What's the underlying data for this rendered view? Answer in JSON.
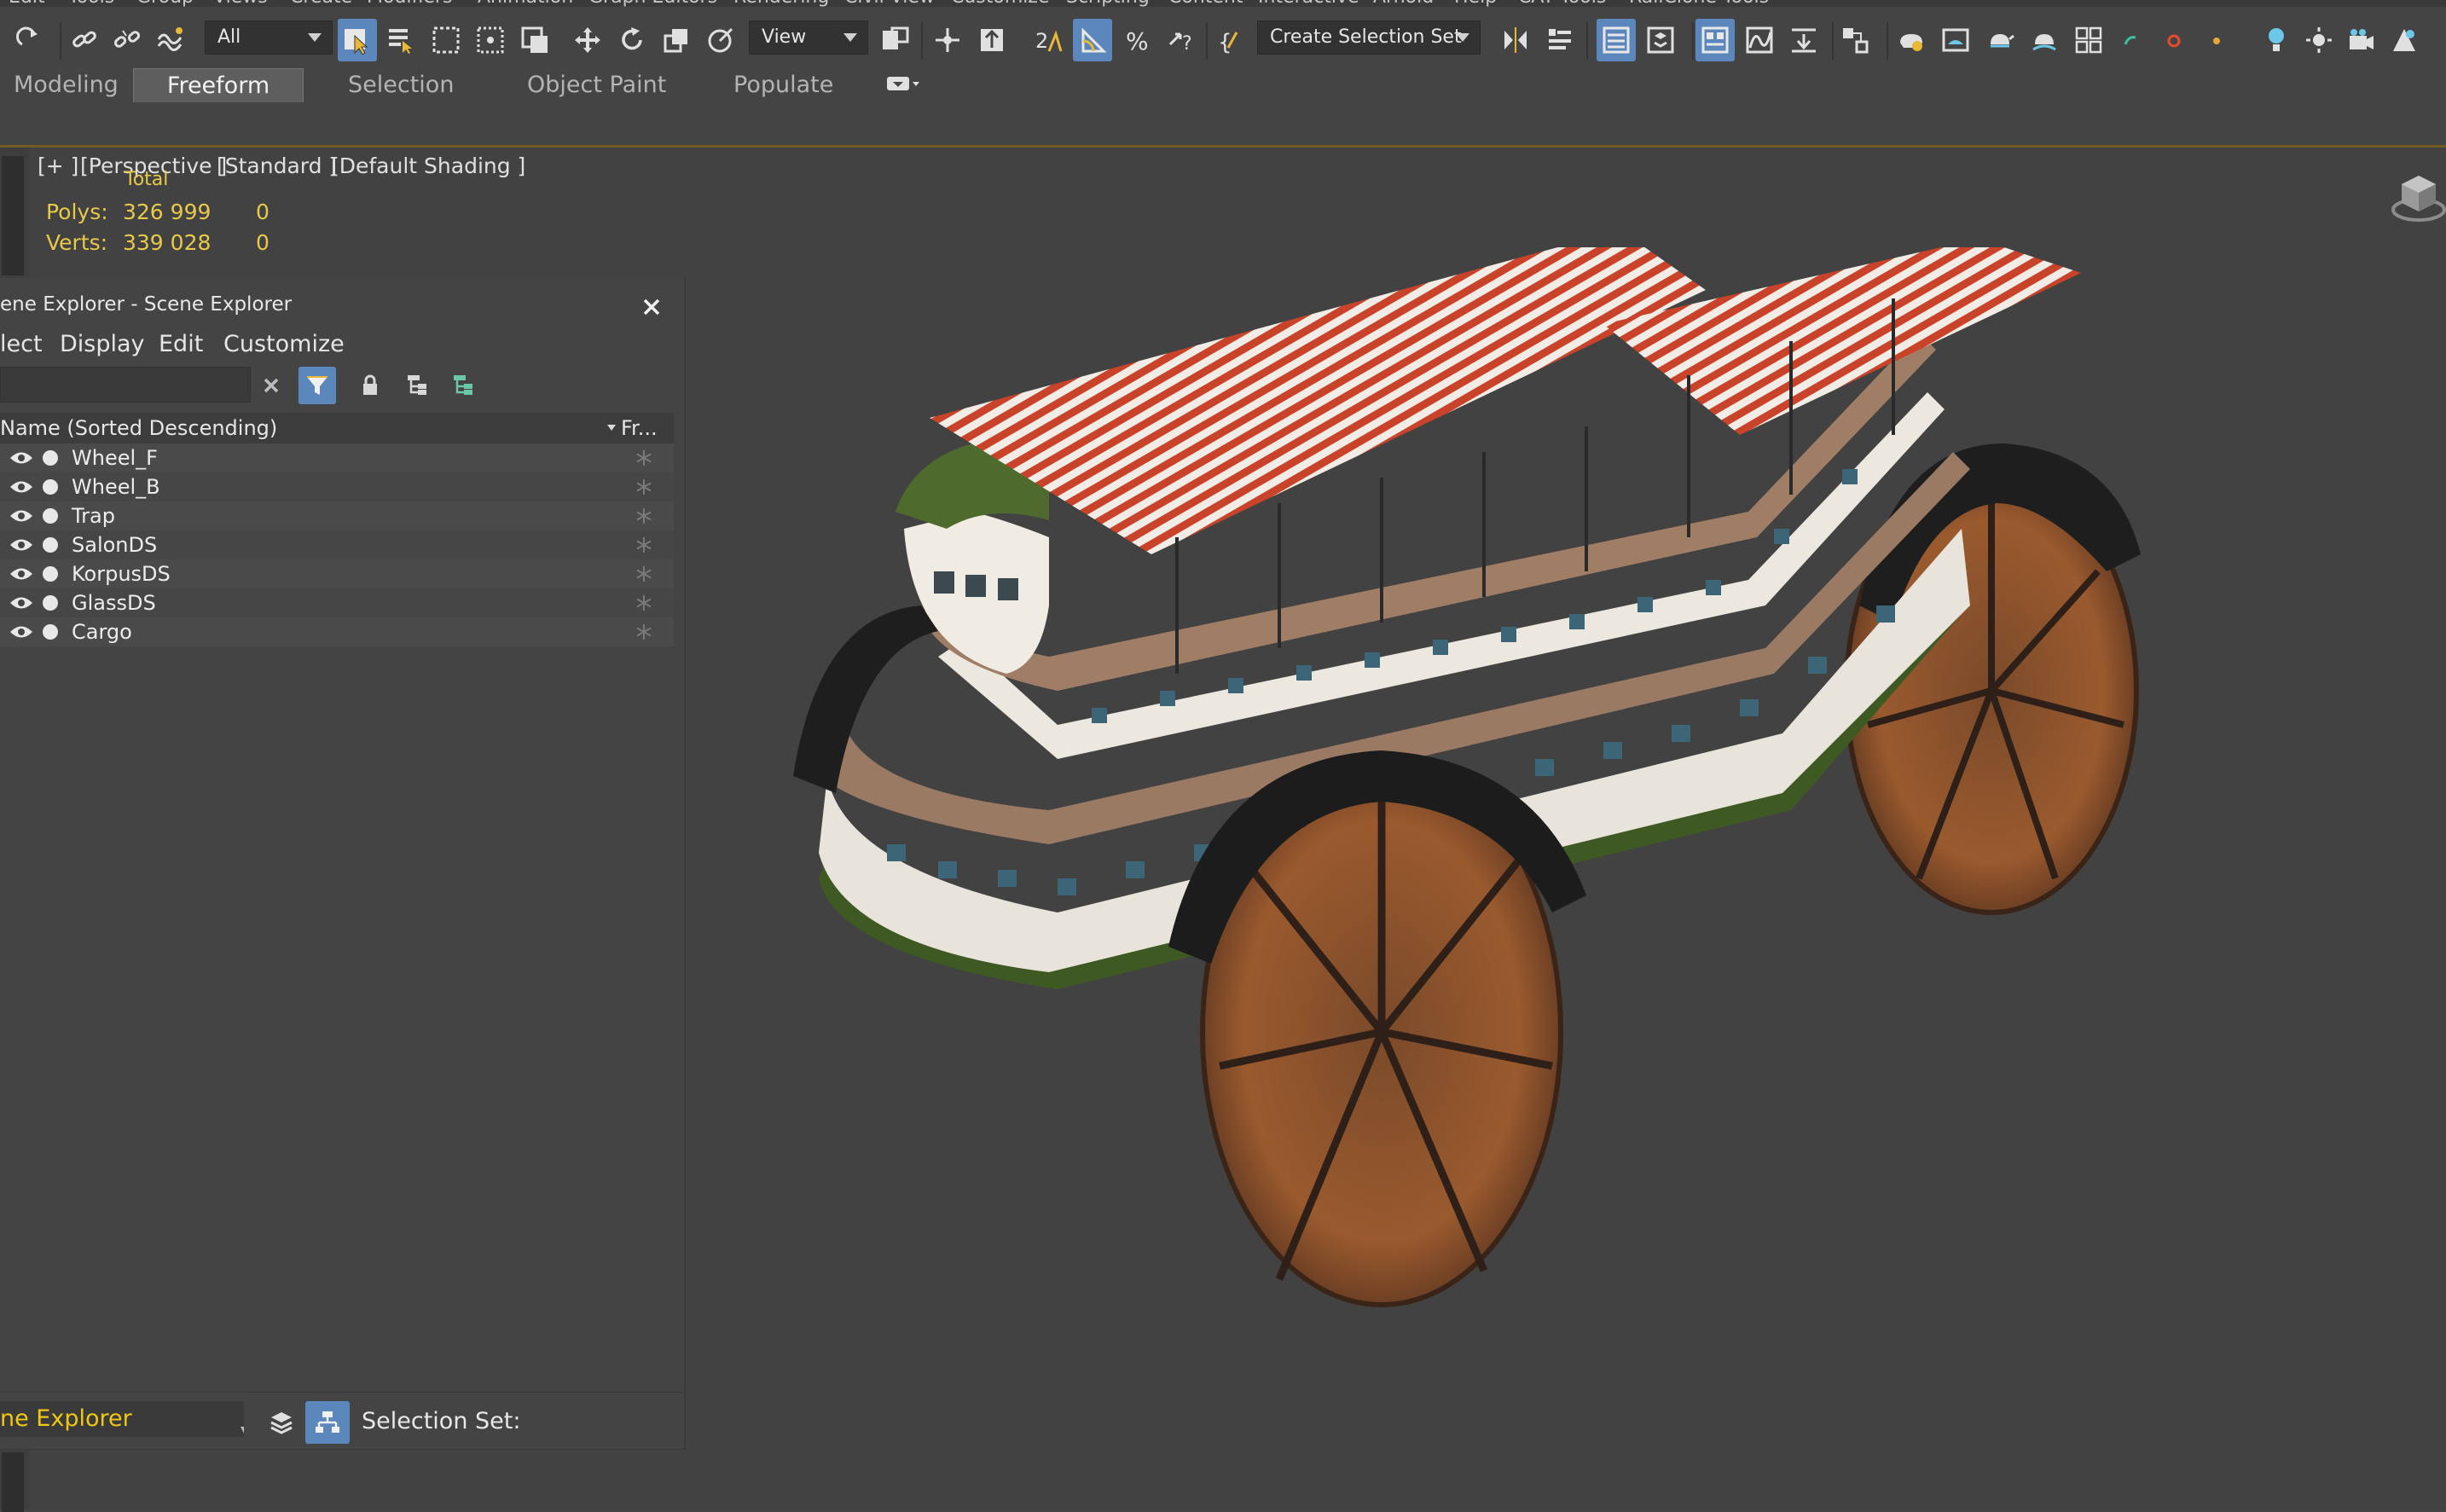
{
  "menubar": {
    "items": [
      "Edit",
      "Tools",
      "Group",
      "Views",
      "Create",
      "Modifiers",
      "Animation",
      "Graph Editors",
      "Rendering",
      "Civil View",
      "Customize",
      "Scripting",
      "Content",
      "Interactive",
      "Arnold",
      "Help",
      "CAT Tools",
      "RailClone Tools"
    ]
  },
  "toolbar": {
    "selection_filter": "All",
    "reference_coord": "View",
    "named_selection_set": "Create Selection Set"
  },
  "ribbon": {
    "tabs": [
      {
        "label": "Modeling",
        "active": false
      },
      {
        "label": "Freeform",
        "active": true
      },
      {
        "label": "Selection",
        "active": false
      },
      {
        "label": "Object Paint",
        "active": false
      },
      {
        "label": "Populate",
        "active": false
      }
    ]
  },
  "viewport": {
    "label_plus": "[+ ]",
    "label_view": "[Perspective ]",
    "label_standard": "[Standard ]",
    "label_shading": "[Default Shading ]",
    "stats": {
      "total_label": "Total",
      "polys_label": "Polys:",
      "polys_total": "326 999",
      "polys_sel": "0",
      "verts_label": "Verts:",
      "verts_total": "339 028",
      "verts_sel": "0"
    }
  },
  "scene_explorer": {
    "title": "ene Explorer - Scene Explorer",
    "menu": [
      "lect",
      "Display",
      "Edit",
      "Customize"
    ],
    "column_name": "Name (Sorted Descending)",
    "column_frozen": "Fr...",
    "objects": [
      "Wheel_F",
      "Wheel_B",
      "Trap",
      "SalonDS",
      "KorpusDS",
      "GlassDS",
      "Cargo"
    ],
    "footer_explorer": "ne Explorer",
    "footer_selection_set": "Selection Set:"
  },
  "colors": {
    "accent_blue": "#5b87bd",
    "stats_yellow": "#e8c94b",
    "explorer_name_yellow": "#f0c814",
    "viewport_bg": "#424242"
  }
}
